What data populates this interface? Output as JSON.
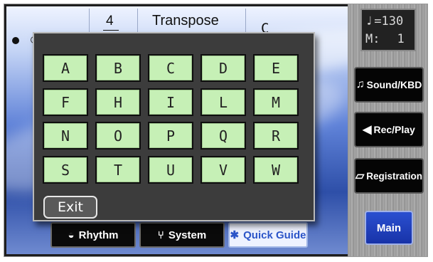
{
  "status": {
    "meter_numerator": "4",
    "meter_denominator": "4",
    "transpose_label": "Transpose",
    "transpose_value": "C",
    "key_value": "C"
  },
  "bottom_buttons": {
    "rhythm": "Rhythm",
    "system": "System",
    "quick_guide": "Quick Guide"
  },
  "dialog": {
    "letters": [
      "A",
      "B",
      "C",
      "D",
      "E",
      "F",
      "H",
      "I",
      "L",
      "M",
      "N",
      "O",
      "P",
      "Q",
      "R",
      "S",
      "T",
      "U",
      "V",
      "W"
    ],
    "exit_label": "Exit"
  },
  "panel": {
    "tempo_symbol": "♩",
    "tempo_value": "=130",
    "measure_label": "M:",
    "measure_value": "1",
    "sound_kbd": "Sound/KBD",
    "rec_play": "Rec/Play",
    "registration": "Registration",
    "main": "Main"
  },
  "icons": {
    "sound_kbd": "music-note-icon",
    "rec_play": "speaker-icon",
    "registration": "book-icon",
    "rhythm": "drum-icon",
    "system": "tuning-fork-icon"
  },
  "colors": {
    "letter_key": "#c6f0b6",
    "dialog_bg": "#3c3c3c",
    "main_button": "#2a4fd0"
  }
}
